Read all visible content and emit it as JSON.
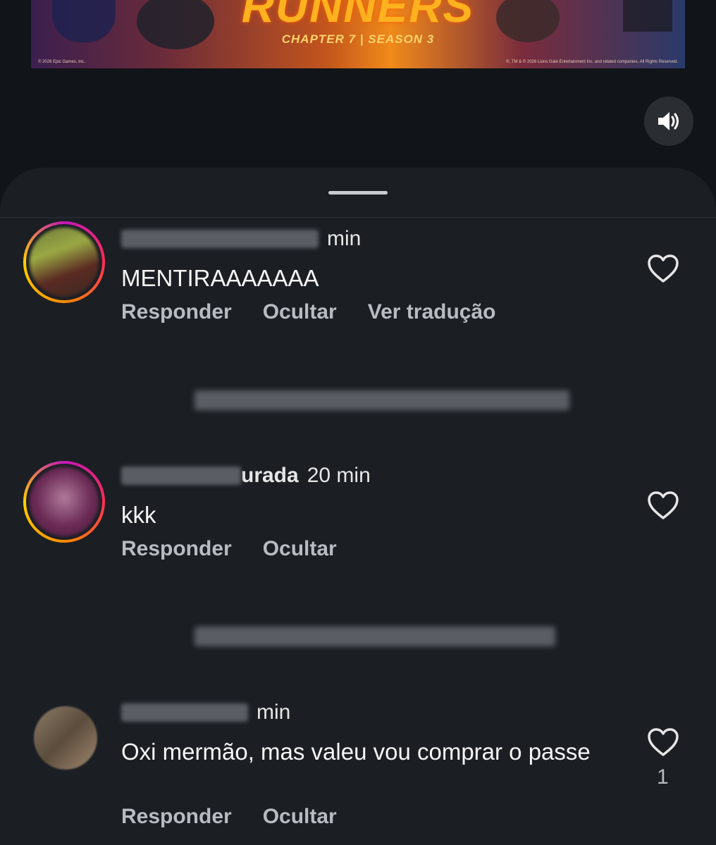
{
  "banner": {
    "title": "RUNNERS",
    "subtitle": "CHAPTER 7 | SEASON 3",
    "copyright_left": "© 2026 Epic Games, Inc.",
    "copyright_right": "®, TM & © 2026 Lions Gate Entertainment Inc. and related companies. All Rights Reserved."
  },
  "sound_button": {
    "icon": "speaker-on-icon"
  },
  "comments": [
    {
      "time": "min",
      "text": "MENTIRAAAAAAA",
      "actions": [
        "Responder",
        "Ocultar",
        "Ver tradução"
      ],
      "likes": ""
    },
    {
      "time": "20 min",
      "name_visible_suffix": "urada",
      "text": "kkk",
      "actions": [
        "Responder",
        "Ocultar"
      ],
      "likes": ""
    },
    {
      "time": "min",
      "text": "Oxi mermão, mas valeu vou comprar o passe",
      "actions": [
        "Responder",
        "Ocultar"
      ],
      "likes": "1"
    }
  ],
  "colors": {
    "background": "#111418",
    "sheet": "#1b1f24",
    "action_text": "#b8bcc2"
  }
}
